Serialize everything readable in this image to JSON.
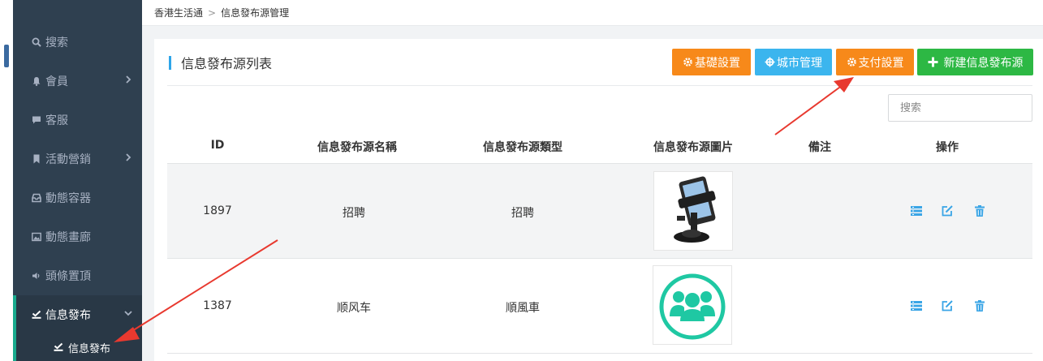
{
  "breadcrumb": {
    "home": "香港生活通",
    "current": "信息發布源管理"
  },
  "sidebar": {
    "items": [
      {
        "label": "搜索",
        "icon": "search-icon"
      },
      {
        "label": "會員",
        "icon": "bell-icon"
      },
      {
        "label": "客服",
        "icon": "comment-icon"
      },
      {
        "label": "活動營銷",
        "icon": "bookmark-icon"
      },
      {
        "label": "動態容器",
        "icon": "inbox-icon"
      },
      {
        "label": "動態畫廊",
        "icon": "image-icon"
      },
      {
        "label": "頭條置頂",
        "icon": "volume-icon"
      },
      {
        "label": "信息發布",
        "icon": "check-square-icon"
      }
    ],
    "sub_item": {
      "label": "信息發布",
      "icon": "check-square-icon"
    }
  },
  "panel": {
    "title": "信息發布源列表",
    "buttons": {
      "basic_settings": "基礎設置",
      "city_management": "城市管理",
      "payment_settings": "支付設置",
      "new_source": "新建信息發布源"
    },
    "search_placeholder": "搜索"
  },
  "table": {
    "headers": [
      "ID",
      "信息發布源名稱",
      "信息發布源類型",
      "信息發布源圖片",
      "備注",
      "操作"
    ],
    "rows": [
      {
        "id": "1897",
        "name": "招聘",
        "type": "招聘",
        "remark": "",
        "image": "phone-holder-photo"
      },
      {
        "id": "1387",
        "name": "顺风车",
        "type": "順風車",
        "remark": "",
        "image": "group-users-icon"
      }
    ]
  },
  "colors": {
    "sidebar_bg": "#2f4050",
    "orange": "#f7891a",
    "blue": "#3bb5ee",
    "green": "#2db844",
    "teal": "#1fc8a3",
    "arrow_red": "#e8392f"
  }
}
